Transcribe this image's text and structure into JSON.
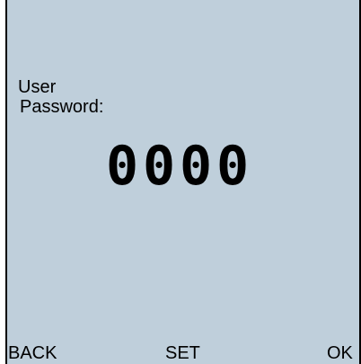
{
  "prompt": {
    "line1": "User",
    "line2": "Password:"
  },
  "password": {
    "digits": [
      "0",
      "0",
      "0",
      "0"
    ]
  },
  "softkeys": {
    "back": "BACK",
    "set": "SET",
    "ok": "OK"
  },
  "colors": {
    "screen_background": "#bfcfdb",
    "text": "#000000"
  }
}
